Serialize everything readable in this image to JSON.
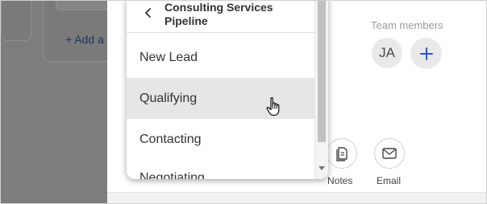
{
  "background": {
    "add_label": "+ Add a"
  },
  "panel": {
    "team_members_label": "Team members",
    "avatar_initials": "JA",
    "actions": [
      {
        "label": "Notes",
        "icon": "notes-icon"
      },
      {
        "label": "Email",
        "icon": "mail-icon"
      }
    ]
  },
  "dropdown": {
    "title": "Consulting Services Pipeline",
    "back_icon": "chevron-left-icon",
    "items": [
      {
        "label": "New Lead"
      },
      {
        "label": "Qualifying"
      },
      {
        "label": "Contacting"
      },
      {
        "label": "Negotiating"
      }
    ]
  },
  "colors": {
    "accent": "#2a58c7",
    "overlay": "#7d7d7d",
    "hover_row": "#e6e6e7"
  }
}
